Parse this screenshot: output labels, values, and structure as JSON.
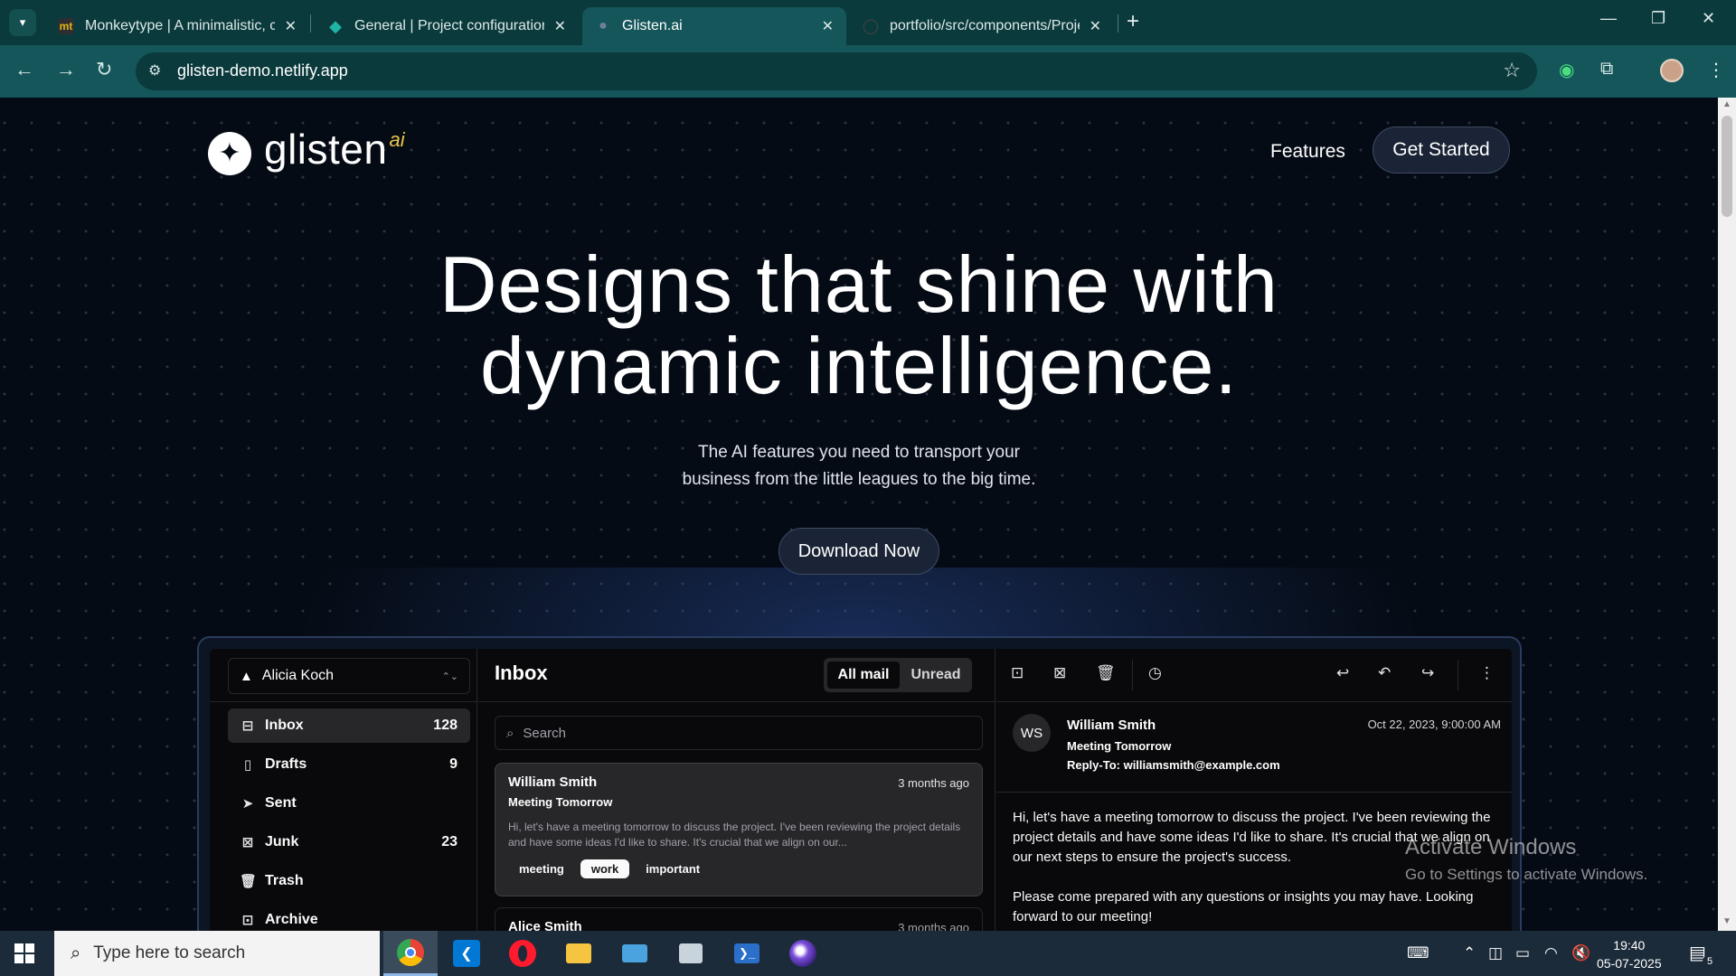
{
  "browser": {
    "tabs": [
      {
        "favicon": "mt",
        "title": "Monkeytype | A minimalistic, cu",
        "close": "✕"
      },
      {
        "favicon": "◆",
        "title": "General | Project configuration |",
        "close": "✕"
      },
      {
        "favicon": "●",
        "title": "Glisten.ai",
        "close": "✕"
      },
      {
        "favicon": "◯",
        "title": "portfolio/src/components/Proje",
        "close": "✕"
      }
    ],
    "active_tab_index": 2,
    "new_tab": "+",
    "url": "glisten-demo.netlify.app",
    "icons": {
      "tab_search": "chevron-down-icon",
      "back": "arrow-left-icon",
      "forward": "arrow-right-icon",
      "reload": "reload-icon",
      "site_info": "tune-icon",
      "bookmark": "star-icon",
      "extension_1": "green-ring-icon",
      "extensions": "puzzle-icon",
      "profile": "avatar",
      "menu": "kebab-icon"
    }
  },
  "site": {
    "logo": {
      "text": "glisten",
      "suffix": "ai"
    },
    "nav": {
      "features": "Features",
      "cta": "Get Started"
    },
    "hero": {
      "title_line1": "Designs that shine with",
      "title_line2": "dynamic intelligence.",
      "subtitle_line1": "The AI features you need to transport your",
      "subtitle_line2": "business from the little leagues to the big time.",
      "cta": "Download Now"
    }
  },
  "mail": {
    "account": "Alicia Koch",
    "folders": [
      {
        "label": "Inbox",
        "count": "128",
        "icon": "inbox-icon"
      },
      {
        "label": "Drafts",
        "count": "9",
        "icon": "file-icon"
      },
      {
        "label": "Sent",
        "count": "",
        "icon": "send-icon"
      },
      {
        "label": "Junk",
        "count": "23",
        "icon": "archive-x-icon"
      },
      {
        "label": "Trash",
        "count": "",
        "icon": "trash-icon"
      },
      {
        "label": "Archive",
        "count": "",
        "icon": "archive-icon"
      }
    ],
    "list_title": "Inbox",
    "filter": {
      "all": "All mail",
      "unread": "Unread"
    },
    "search_placeholder": "Search",
    "messages": [
      {
        "from": "William Smith",
        "date": "3 months ago",
        "subject": "Meeting Tomorrow",
        "preview": "Hi, let's have a meeting tomorrow to discuss the project. I've been reviewing the project details and have some ideas I'd like to share. It's crucial that we align on our...",
        "tags": [
          "meeting",
          "work",
          "important"
        ]
      },
      {
        "from": "Alice Smith",
        "date": "3 months ago"
      }
    ],
    "reader": {
      "initials": "WS",
      "from": "William Smith",
      "subject": "Meeting Tomorrow",
      "reply_to": "Reply-To: williamsmith@example.com",
      "date": "Oct 22, 2023, 9:00:00 AM",
      "body_p1": "Hi, let's have a meeting tomorrow to discuss the project. I've been reviewing the project details and have some ideas I'd like to share. It's crucial that we align on our next steps to ensure the project's success.",
      "body_p2": "Please come prepared with any questions or insights you may have. Looking forward to our meeting!",
      "toolbar_icons": [
        "archive-icon",
        "archive-x-icon",
        "trash-icon",
        "clock-icon",
        "reply-icon",
        "reply-all-icon",
        "forward-icon",
        "kebab-icon"
      ]
    }
  },
  "watermark": {
    "line1": "Activate Windows",
    "line2": "Go to Settings to activate Windows."
  },
  "taskbar": {
    "search_placeholder": "Type here to search",
    "apps": [
      "chrome-icon",
      "vscode-icon",
      "opera-icon",
      "file-explorer-icon",
      "laptop-app-icon",
      "printer-app-icon",
      "powershell-icon",
      "browser-orb-icon"
    ],
    "time": "19:40",
    "date": "05-07-2025",
    "notifications": "5"
  }
}
